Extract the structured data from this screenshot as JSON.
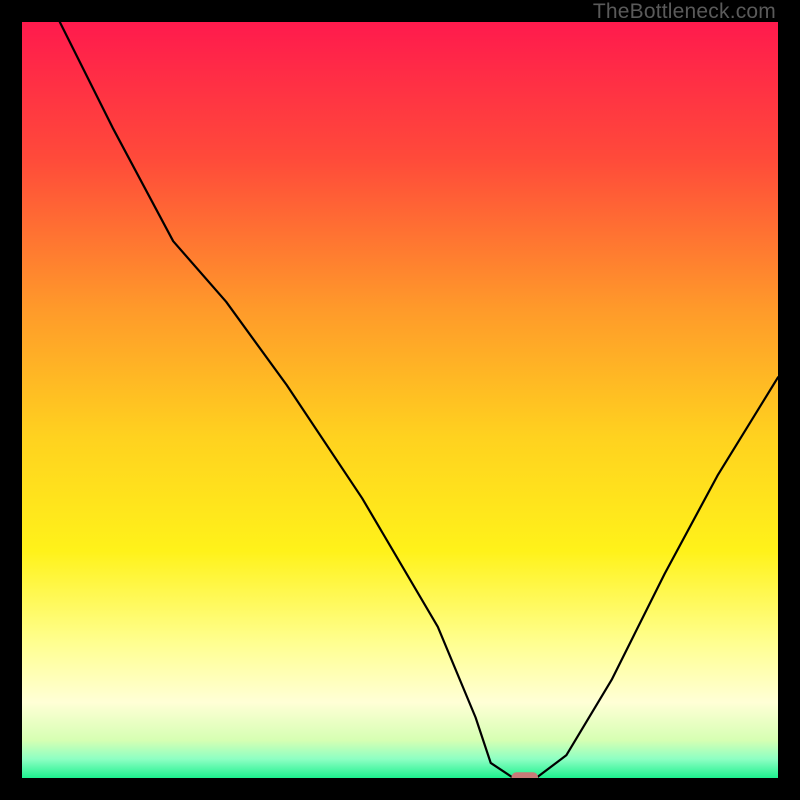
{
  "watermark": "TheBottleneck.com",
  "chart_data": {
    "type": "line",
    "title": "",
    "xlabel": "",
    "ylabel": "",
    "xlim": [
      0,
      100
    ],
    "ylim": [
      0,
      100
    ],
    "grid": false,
    "legend": false,
    "background_gradient": {
      "stops": [
        {
          "offset": 0.0,
          "color": "#ff1a4d"
        },
        {
          "offset": 0.18,
          "color": "#ff4a3a"
        },
        {
          "offset": 0.38,
          "color": "#ff9a2a"
        },
        {
          "offset": 0.55,
          "color": "#ffd21f"
        },
        {
          "offset": 0.7,
          "color": "#fff21a"
        },
        {
          "offset": 0.82,
          "color": "#ffff8f"
        },
        {
          "offset": 0.9,
          "color": "#ffffd6"
        },
        {
          "offset": 0.95,
          "color": "#d6ffb3"
        },
        {
          "offset": 0.975,
          "color": "#8dffc3"
        },
        {
          "offset": 1.0,
          "color": "#1df08e"
        }
      ]
    },
    "curve": {
      "x": [
        5,
        12,
        20,
        27,
        35,
        45,
        55,
        60,
        62,
        65,
        68,
        72,
        78,
        85,
        92,
        100
      ],
      "y": [
        100,
        86,
        71,
        63,
        52,
        37,
        20,
        8,
        2,
        0,
        0,
        3,
        13,
        27,
        40,
        53
      ]
    },
    "marker": {
      "x": 66.5,
      "y": 0,
      "color": "#c97a78",
      "width": 3.5,
      "height": 1.5
    }
  }
}
